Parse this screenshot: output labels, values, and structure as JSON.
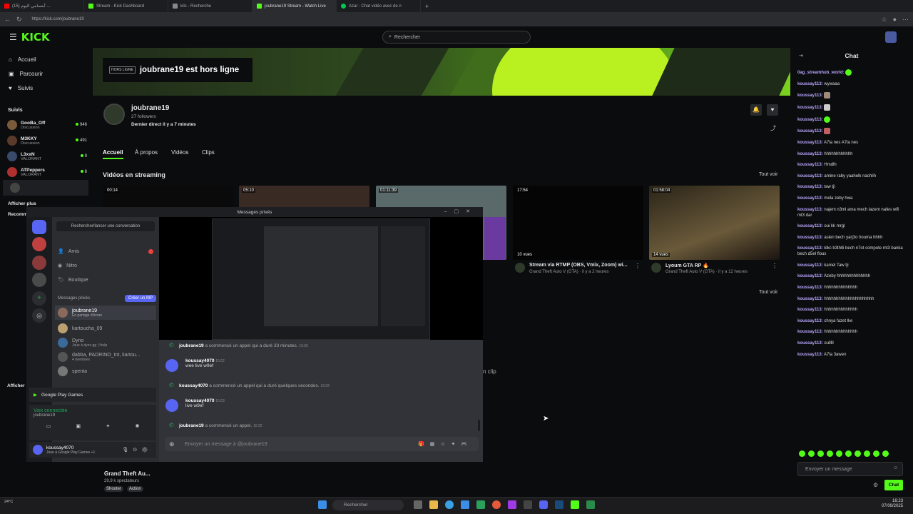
{
  "browser": {
    "tabs": [
      {
        "label": "(15) أبتسامي اليوم ...",
        "color": "#ff0000"
      },
      {
        "label": "Stream - Kick Dashboard",
        "color": "#53fc18"
      },
      {
        "label": "kilc - Recherche",
        "color": "#888888"
      },
      {
        "label": "joubrane19 Stream - Watch Live",
        "color": "#53fc18"
      },
      {
        "label": "Azar : Chat vidéo avec de n",
        "color": "#00c853"
      }
    ],
    "url": "https://kick.com/joubrane19"
  },
  "header": {
    "logo": "KICK",
    "search_placeholder": "Rechercher"
  },
  "sidebar": {
    "nav": [
      "Accueil",
      "Parcourir",
      "Suivis"
    ],
    "suivis_title": "Suivis",
    "follows": [
      {
        "name": "GooBa_Off",
        "category": "Discussion",
        "count": "946",
        "color": "#7a5a3a"
      },
      {
        "name": "M3KKY",
        "category": "Discussion",
        "count": "491",
        "color": "#5a3a2a"
      },
      {
        "name": "L3xxN",
        "category": "VALORANT",
        "count": "9",
        "color": "#3a4a6a"
      },
      {
        "name": "ATPeppers",
        "category": "VALORANT",
        "count": "8",
        "color": "#b03030"
      },
      {
        "name": "",
        "category": "",
        "count": "",
        "color": "#444444"
      }
    ],
    "show_more": "Afficher plus",
    "recommended_title": "Recomm",
    "show_more_2": "Afficher"
  },
  "banner": {
    "offline_tag": "HORS LIGNE",
    "offline_text": "joubrane19 est hors ligne"
  },
  "profile": {
    "name": "joubrane19",
    "followers": "27 followers",
    "last_live": "Dernier direct il y a 7 minutes"
  },
  "tabs": [
    "Accueil",
    "À propos",
    "Vidéos",
    "Clips"
  ],
  "videos_section": {
    "title": "Vidéos en streaming",
    "see_all": "Tout voir",
    "see_all_2": "Tout voir"
  },
  "videos": [
    {
      "duration": "00:14"
    },
    {
      "duration": "05:10"
    },
    {
      "duration": "01:11:39"
    },
    {
      "duration": "17:54",
      "views": "10 vues",
      "title": "Stream via RTMP (OBS, Vmix, Zoom) wi...",
      "meta": "Grand Theft Auto V (GTA) · il y a 2 heures"
    },
    {
      "duration": "01:58:04",
      "views": "14 vues",
      "title": "Lyoum GTA RP 🔥",
      "meta": "Grand Theft Auto V (GTA) · il y a 12 heures"
    }
  ],
  "clips_fragment": "n clip",
  "bottom_card": {
    "title": "Grand Theft Au...",
    "viewers": "29,9 k spectateurs",
    "tags": [
      "Shooter",
      "Action"
    ]
  },
  "chat": {
    "title": "Chat",
    "messages": [
      {
        "user": "0ag_streamhub_world:",
        "text": ""
      },
      {
        "user": "koussay113:",
        "text": "wywaaa"
      },
      {
        "user": "koussay113:",
        "text": ""
      },
      {
        "user": "koussay113:",
        "text": ""
      },
      {
        "user": "koussay113:",
        "text": ""
      },
      {
        "user": "koussay113:",
        "text": ""
      },
      {
        "user": "koussay113:",
        "text": "A7la nes A7la nes"
      },
      {
        "user": "koussay113:",
        "text": "hhhhhhhhhhhh"
      },
      {
        "user": "koussay113:",
        "text": "Hmdlh"
      },
      {
        "user": "koussay113:",
        "text": "amine raby yaahelk nachlih"
      },
      {
        "user": "koussay113:",
        "text": "taw tji"
      },
      {
        "user": "koussay113:",
        "text": "mela zeby hwa"
      },
      {
        "user": "koussay113:",
        "text": "najem n3ml ama mech lazem nafes wifi mt3 dar"
      },
      {
        "user": "koussay113:",
        "text": "oui kk mrgl"
      },
      {
        "user": "koussay113:",
        "text": "aslen bech yarj3o houma hhhh"
      },
      {
        "user": "koussay113:",
        "text": "klkc b3thtli bech n7ot compote mt3 banka bech d5el flous"
      },
      {
        "user": "koussay113:",
        "text": "kamel Taw tji"
      },
      {
        "user": "koussay113:",
        "text": "Azeby hhhhhhhhhhhhhh"
      },
      {
        "user": "koussay113:",
        "text": "hhhhhhhhhhhhhh"
      },
      {
        "user": "koussay113:",
        "text": "hhhhhhhhhhhhhhhhhhhhh"
      },
      {
        "user": "koussay113:",
        "text": "hhhhhhhhhhhhhh"
      },
      {
        "user": "koussay113:",
        "text": "chnya fazet lke"
      },
      {
        "user": "koussay113:",
        "text": "hhhhhhhhhhhhhh"
      },
      {
        "user": "koussay113:",
        "text": "oulllll"
      },
      {
        "user": "koussay113:",
        "text": "A7la 3awen"
      }
    ],
    "input_placeholder": "Envoyer un message",
    "send_label": "Chat"
  },
  "discord": {
    "window_title": "Messages privés",
    "search_label": "Rechercher/lancer une conversation",
    "menu": [
      "Amis",
      "Nitro",
      "Boutique"
    ],
    "dm_title": "Messages privés",
    "create_dm": "Créer un MP",
    "dms": [
      {
        "name": "joubrane19",
        "sub": "En partage d'écran"
      },
      {
        "name": "kartoucha_09",
        "sub": ""
      },
      {
        "name": "Dyno",
        "sub": "Joue à dyno.gg | !help"
      },
      {
        "name": "dabba, PADRINO_tnt, kartou...",
        "sub": "4 membres"
      },
      {
        "name": "spenta",
        "sub": ""
      }
    ],
    "activity": "Google Play Games",
    "voice_status": "Voix connectée",
    "voice_user": "joubrane19",
    "me_name": "koussay4070",
    "me_status": "Joue à Google Play Games +1",
    "messages": [
      {
        "kind": "sys",
        "user": "joubrane19",
        "text": "a commencé un appel qui a duré 33 minutes.",
        "time": "15:56"
      },
      {
        "kind": "msg",
        "user": "koussay4070",
        "time": "16:02",
        "text": "wee live w9ef"
      },
      {
        "kind": "sys",
        "user": "koussay4070",
        "text": "a commencé un appel qui a duré quelques secondes.",
        "time": "16:02"
      },
      {
        "kind": "msg",
        "user": "koussay4070",
        "time": "16:03",
        "text": "live w9ef"
      },
      {
        "kind": "sys",
        "user": "joubrane19",
        "text": "a commencé un appel.",
        "time": "16:22"
      }
    ],
    "input_placeholder": "Envoyer un message à @joubrane19"
  },
  "taskbar": {
    "search": "Rechercher",
    "time": "16:23",
    "date": "07/09/2025",
    "weather": "24°C"
  }
}
